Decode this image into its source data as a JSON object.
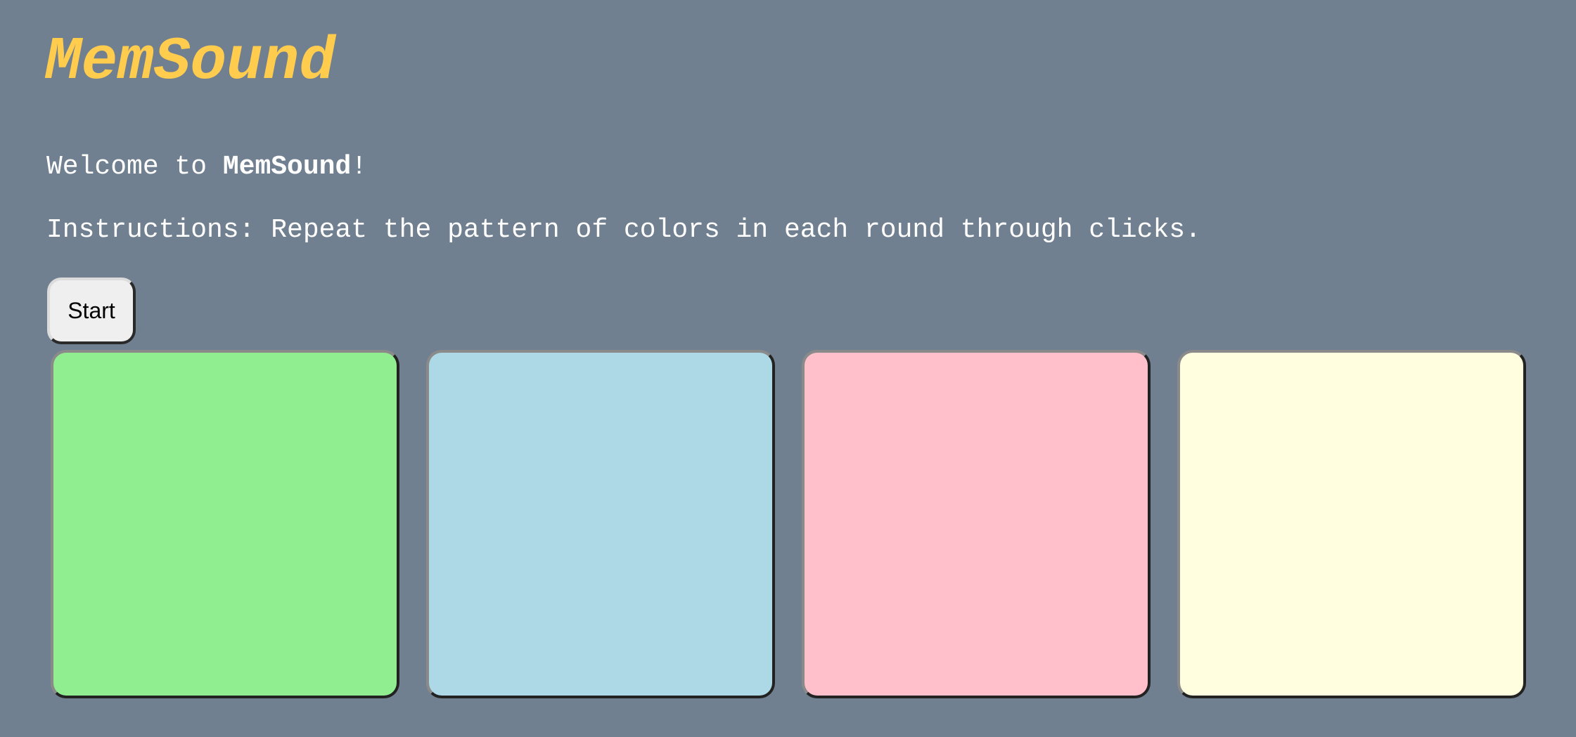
{
  "header": {
    "title": "MemSound"
  },
  "intro": {
    "welcome_prefix": "Welcome to ",
    "welcome_name": "MemSound",
    "welcome_suffix": "!",
    "instructions": "Instructions: Repeat the pattern of colors in each round through clicks."
  },
  "controls": {
    "start_label": "Start"
  },
  "tiles": [
    {
      "name": "green",
      "color": "#90ee90"
    },
    {
      "name": "blue",
      "color": "#add8e6"
    },
    {
      "name": "pink",
      "color": "#ffc0cb"
    },
    {
      "name": "yellow",
      "color": "#ffffe0"
    }
  ],
  "colors": {
    "background": "#708090",
    "title": "#ffcc4d",
    "text": "#ffffff"
  }
}
